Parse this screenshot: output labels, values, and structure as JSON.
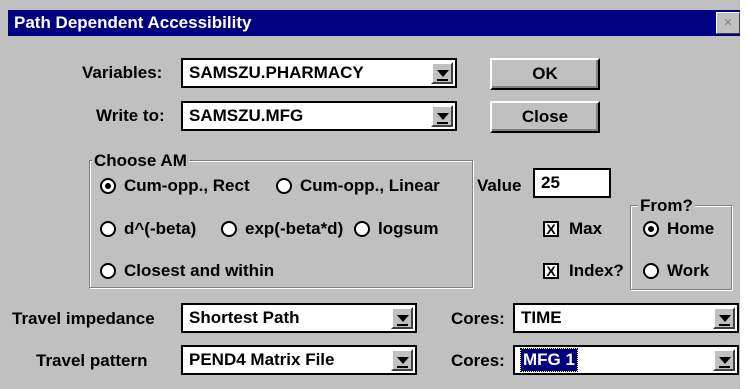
{
  "dialog": {
    "title": "Path Dependent Accessibility",
    "close_glyph": "×"
  },
  "variables": {
    "label": "Variables:",
    "value": "SAMSZU.PHARMACY"
  },
  "write_to": {
    "label": "Write to:",
    "value": "SAMSZU.MFG"
  },
  "buttons": {
    "ok": "OK",
    "close": "Close"
  },
  "choose_am": {
    "label": "Choose AM",
    "options": [
      "Cum-opp., Rect",
      "Cum-opp., Linear",
      "d^(-beta)",
      "exp(-beta*d)",
      "logsum",
      "Closest and within"
    ],
    "selected": "Cum-opp., Rect"
  },
  "value": {
    "label": "Value",
    "input": "25"
  },
  "checks": {
    "max": "Max",
    "index": "Index?",
    "max_checked": true,
    "index_checked": true,
    "check_glyph": "X"
  },
  "from": {
    "label": "From?",
    "home": "Home",
    "work": "Work",
    "selected": "Home"
  },
  "travel_impedance": {
    "label": "Travel impedance",
    "value": "Shortest Path"
  },
  "travel_pattern": {
    "label": "Travel pattern",
    "value": "PEND4 Matrix File"
  },
  "cores1": {
    "label": "Cores:",
    "value": "TIME"
  },
  "cores2": {
    "label": "Cores:",
    "value": "MFG 1"
  }
}
